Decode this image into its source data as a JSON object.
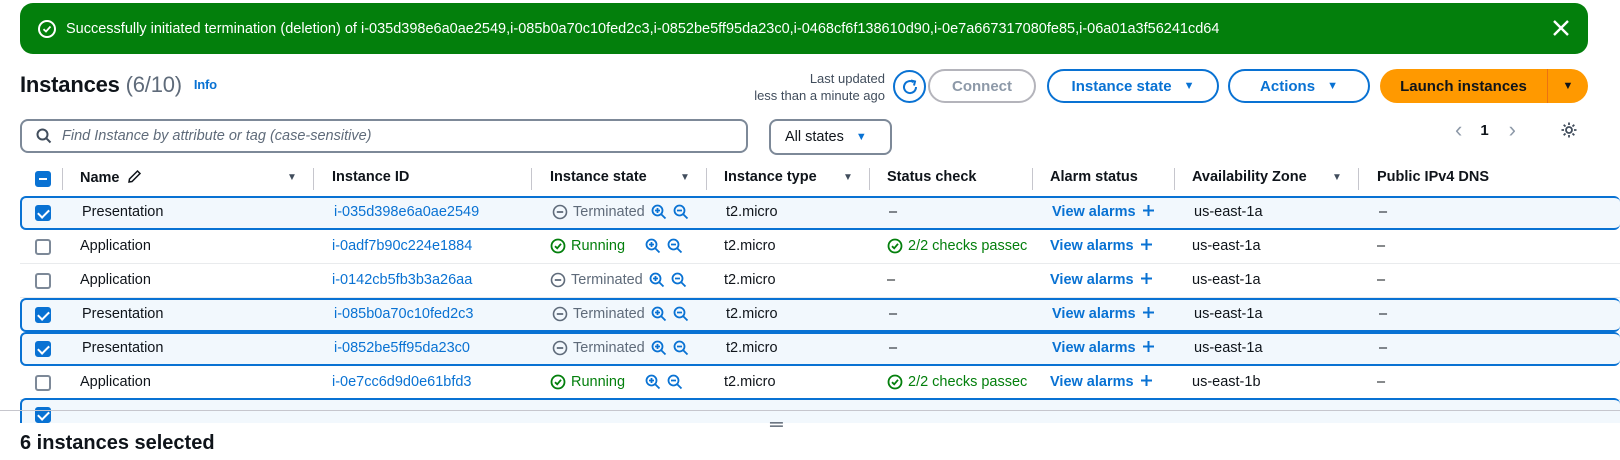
{
  "flash": {
    "message": "Successfully initiated termination (deletion) of i-035d398e6a0ae2549,i-085b0a70c10fed2c3,i-0852be5ff95da23c0,i-0468cf6f138610d90,i-0e7a667317080fe85,i-06a01a3f56241cd64",
    "status_color": "#037f0c"
  },
  "header": {
    "title": "Instances",
    "count": "(6/10)",
    "info": "Info",
    "last_updated_line1": "Last updated",
    "last_updated_line2": "less than a minute ago",
    "connect": "Connect",
    "instance_state": "Instance state",
    "actions": "Actions",
    "launch": "Launch instances"
  },
  "filter": {
    "placeholder": "Find Instance by attribute or tag (case-sensitive)",
    "states": "All states",
    "page": "1"
  },
  "columns": [
    "Name",
    "Instance ID",
    "Instance state",
    "Instance type",
    "Status check",
    "Alarm status",
    "Availability Zone",
    "Public IPv4 DNS"
  ],
  "rows": [
    {
      "name": "Presentation",
      "id": "i-035d398e6a0ae2549",
      "state": "Terminated",
      "type": "t2.micro",
      "check": "–",
      "alarm": "View alarms",
      "az": "us-east-1a",
      "dns": "–",
      "selected": true
    },
    {
      "name": "Application",
      "id": "i-0adf7b90c224e1884",
      "state": "Running",
      "type": "t2.micro",
      "check": "2/2 checks passec",
      "alarm": "View alarms",
      "az": "us-east-1a",
      "dns": "–",
      "selected": false
    },
    {
      "name": "Application",
      "id": "i-0142cb5fb3b3a26aa",
      "state": "Terminated",
      "type": "t2.micro",
      "check": "–",
      "alarm": "View alarms",
      "az": "us-east-1a",
      "dns": "–",
      "selected": false
    },
    {
      "name": "Presentation",
      "id": "i-085b0a70c10fed2c3",
      "state": "Terminated",
      "type": "t2.micro",
      "check": "–",
      "alarm": "View alarms",
      "az": "us-east-1a",
      "dns": "–",
      "selected": true
    },
    {
      "name": "Presentation",
      "id": "i-0852be5ff95da23c0",
      "state": "Terminated",
      "type": "t2.micro",
      "check": "–",
      "alarm": "View alarms",
      "az": "us-east-1a",
      "dns": "–",
      "selected": true
    },
    {
      "name": "Application",
      "id": "i-0e7cc6d9d0e61bfd3",
      "state": "Running",
      "type": "t2.micro",
      "check": "2/2 checks passec",
      "alarm": "View alarms",
      "az": "us-east-1b",
      "dns": "–",
      "selected": false
    }
  ],
  "footer": {
    "selected": "6 instances selected"
  },
  "colors": {
    "accent": "#0972d3",
    "launch": "#ff9900",
    "running": "#037f0c",
    "terminated": "#5f6b7a"
  },
  "icons": [
    "check-circle-icon",
    "close-icon",
    "refresh-icon",
    "caret-down-icon",
    "search-icon",
    "chevron-left-icon",
    "chevron-right-icon",
    "gear-icon",
    "edit-icon",
    "zoom-in-icon",
    "zoom-out-icon",
    "minus-circle-icon",
    "plus-icon",
    "drag-handle-icon"
  ]
}
